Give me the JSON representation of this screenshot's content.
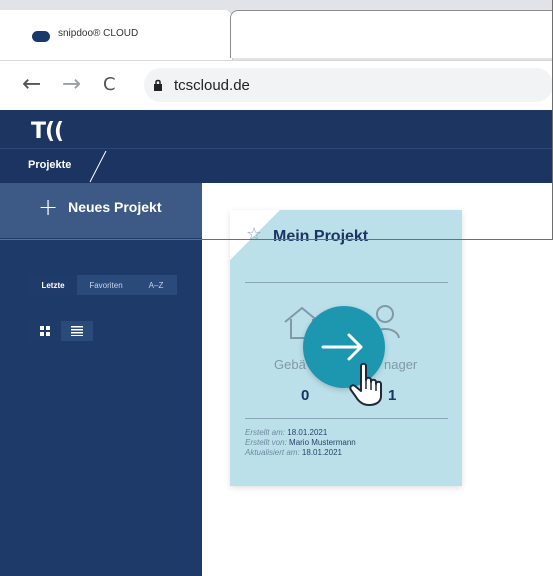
{
  "browser": {
    "tab_title": "snipdoo® CLOUD",
    "url": "tcscloud.de",
    "nav": {
      "back": "←",
      "forward": "→",
      "reload": "C"
    }
  },
  "app": {
    "logo": "T((",
    "breadcrumb": "Projekte"
  },
  "sidebar": {
    "new_project": "Neues Projekt",
    "filters": [
      "Letzte",
      "Favoriten",
      "A–Z"
    ],
    "selected_filter": "Letzte"
  },
  "card": {
    "title": "Mein Projekt",
    "left_label": "Gebä",
    "right_label": "nager",
    "left_value": "0",
    "right_value": "1",
    "created_label": "Erstellt am:",
    "created_value": "18.01.2021",
    "created_by_label": "Erstellt von:",
    "created_by_value": "Mario Mustermann",
    "updated_label": "Aktualisiert am:",
    "updated_value": "18.01.2021"
  },
  "colors": {
    "primary": "#1c3561",
    "sidebar": "#1e3a68",
    "accent": "#1d97b0",
    "card": "#bce0ea"
  }
}
